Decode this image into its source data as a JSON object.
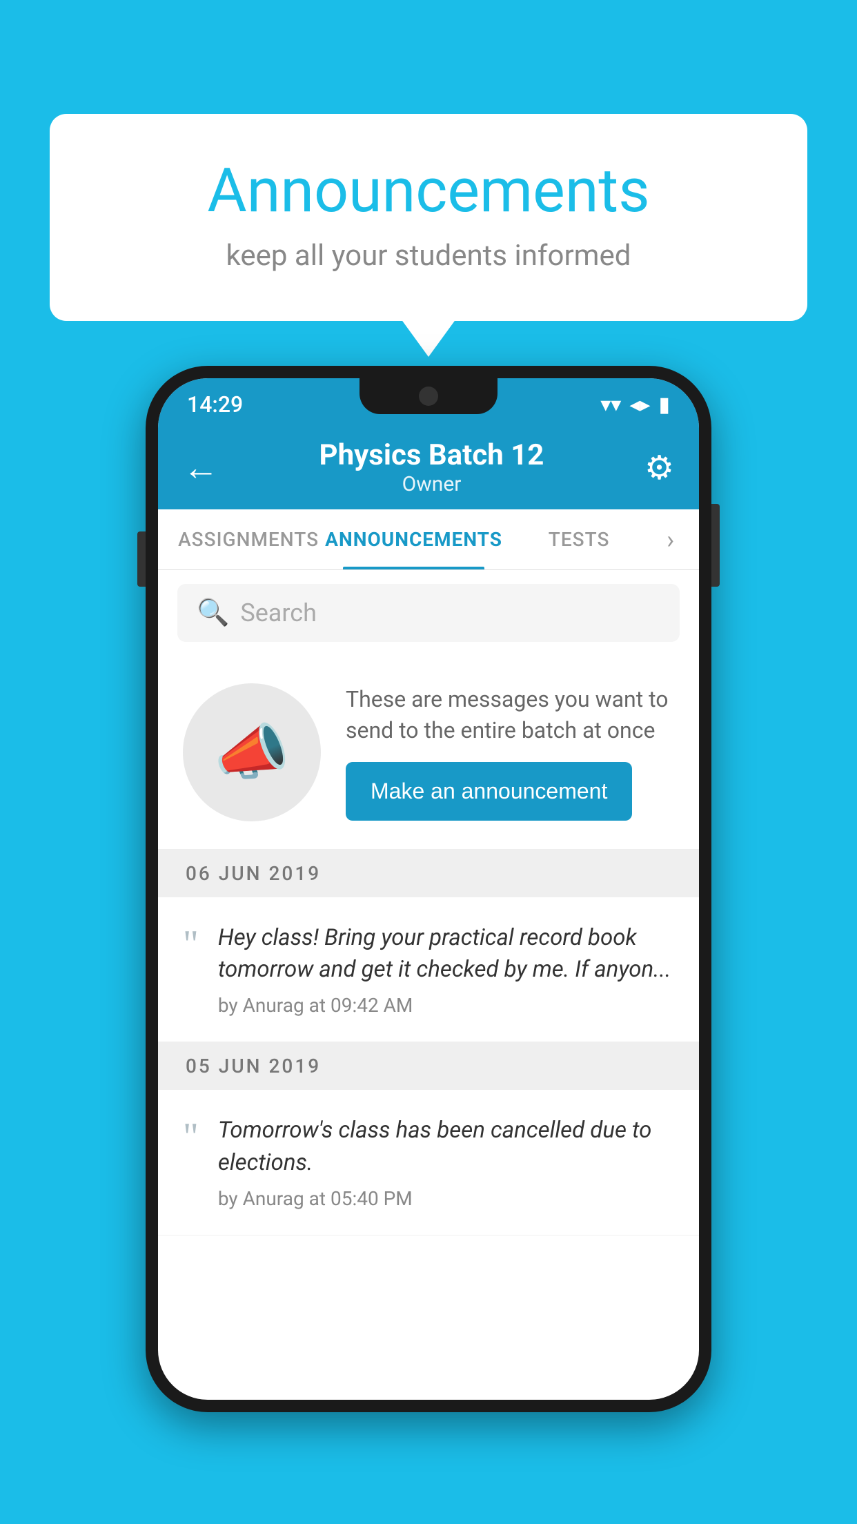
{
  "background_color": "#1bbde8",
  "speech_bubble": {
    "title": "Announcements",
    "subtitle": "keep all your students informed"
  },
  "phone": {
    "status_bar": {
      "time": "14:29",
      "wifi": "▾",
      "signal": "▴",
      "battery": "▮"
    },
    "header": {
      "back_label": "←",
      "title": "Physics Batch 12",
      "subtitle": "Owner",
      "gear_label": "⚙"
    },
    "tabs": [
      {
        "label": "ASSIGNMENTS",
        "active": false
      },
      {
        "label": "ANNOUNCEMENTS",
        "active": true
      },
      {
        "label": "TESTS",
        "active": false
      }
    ],
    "tabs_more": "›",
    "search": {
      "placeholder": "Search"
    },
    "promo": {
      "description": "These are messages you want to send to the entire batch at once",
      "button_label": "Make an announcement"
    },
    "announcements": [
      {
        "date": "06  JUN  2019",
        "text": "Hey class! Bring your practical record book tomorrow and get it checked by me. If anyon...",
        "author": "by Anurag at 09:42 AM"
      },
      {
        "date": "05  JUN  2019",
        "text": "Tomorrow's class has been cancelled due to elections.",
        "author": "by Anurag at 05:40 PM"
      }
    ]
  }
}
